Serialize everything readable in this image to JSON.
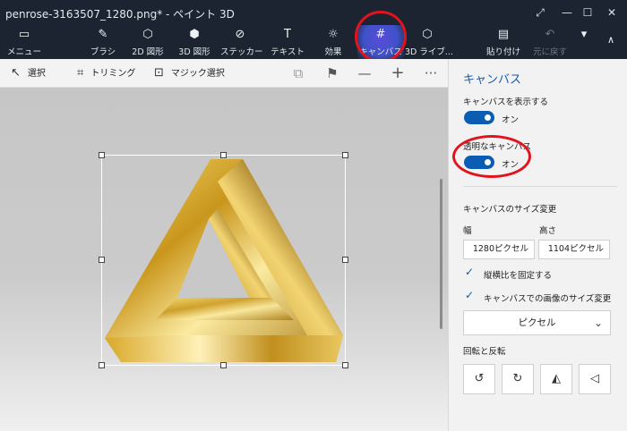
{
  "window": {
    "title": "penrose-3163507_1280.png* - ペイント 3D",
    "controls": {
      "expand": "⤢",
      "minimize": "—",
      "maximize": "☐",
      "close": "✕"
    }
  },
  "toolbar": {
    "items": [
      {
        "label": "メニュー",
        "icon": "folder-icon",
        "glyph": "▭"
      },
      {
        "label": "ブラシ",
        "icon": "brush-icon",
        "glyph": "✎"
      },
      {
        "label": "2D 図形",
        "icon": "2d-shapes-icon",
        "glyph": "⬡"
      },
      {
        "label": "3D 図形",
        "icon": "3d-shapes-icon",
        "glyph": "⬢"
      },
      {
        "label": "ステッカー",
        "icon": "sticker-icon",
        "glyph": "⊘"
      },
      {
        "label": "テキスト",
        "icon": "text-icon",
        "glyph": "T"
      },
      {
        "label": "効果",
        "icon": "effects-icon",
        "glyph": "☼"
      },
      {
        "label": "キャンバス",
        "icon": "canvas-icon",
        "glyph": "#"
      },
      {
        "label": "3D ライブ...",
        "icon": "3d-library-icon",
        "glyph": "⬡"
      },
      {
        "label": "貼り付け",
        "icon": "paste-icon",
        "glyph": "▤"
      },
      {
        "label": "元に戻す",
        "icon": "undo-icon",
        "glyph": "↶"
      }
    ],
    "more_glyph": "▾",
    "active": "キャンバス"
  },
  "subbar": {
    "select": "選択",
    "trim": "トリミング",
    "magic_select": "マジック選択",
    "select_icon": "↖",
    "trim_icon": "⌗",
    "magic_icon": "⊡",
    "extra_icons": {
      "view3d": "⧉",
      "flag": "⚑",
      "zoom_out": "—",
      "zoom_in": "+",
      "more": "···"
    }
  },
  "panel": {
    "title": "キャンバス",
    "show_canvas": {
      "label": "キャンバスを表示する",
      "state": "オン",
      "on": true
    },
    "transparent": {
      "label": "透明なキャンバス",
      "state": "オン",
      "on": true
    },
    "resize": {
      "label": "キャンバスのサイズ変更",
      "width_label": "幅",
      "height_label": "高さ",
      "width_value": "1280ピクセル",
      "height_value": "1104ピクセル",
      "lock_aspect": "縦横比を固定する",
      "resize_image": "キャンバスでの画像のサイズ変更",
      "unit": "ピクセル",
      "unit_chevron": "⌄"
    },
    "rotate": {
      "label": "回転と反転",
      "buttons": [
        {
          "icon": "rotate-left-icon",
          "glyph": "↺"
        },
        {
          "icon": "rotate-right-icon",
          "glyph": "↻"
        },
        {
          "icon": "flip-horizontal-icon",
          "glyph": "◭"
        },
        {
          "icon": "flip-vertical-icon",
          "glyph": "◁"
        }
      ]
    }
  },
  "colors": {
    "accent": "#0b5cb3",
    "highlight": "#e0141c",
    "titlebar": "#1b2430"
  }
}
